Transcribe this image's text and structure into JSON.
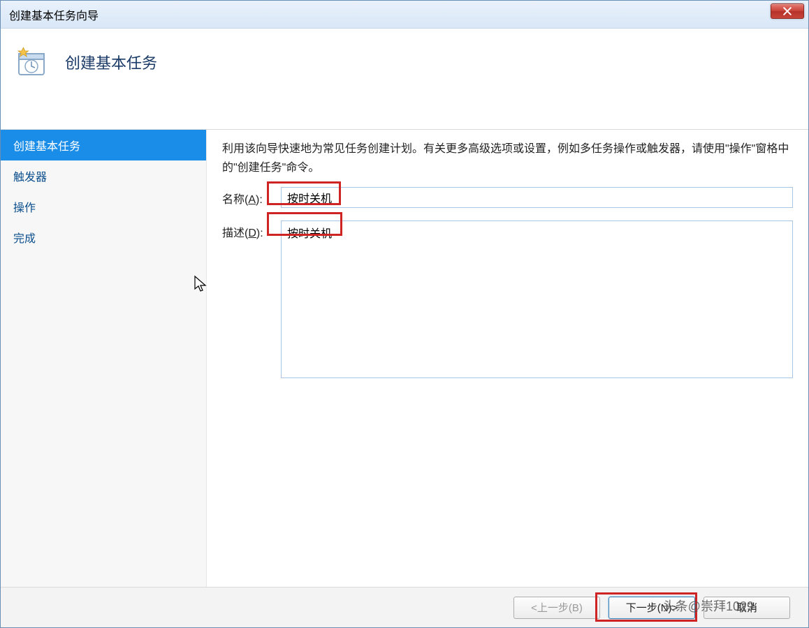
{
  "window": {
    "title": "创建基本任务向导"
  },
  "header": {
    "title": "创建基本任务"
  },
  "sidebar": {
    "items": [
      {
        "label": "创建基本任务",
        "active": true
      },
      {
        "label": "触发器",
        "active": false
      },
      {
        "label": "操作",
        "active": false
      },
      {
        "label": "完成",
        "active": false
      }
    ]
  },
  "main": {
    "intro": "利用该向导快速地为常见任务创建计划。有关更多高级选项或设置，例如多任务操作或触发器，请使用\"操作\"窗格中的\"创建任务\"命令。",
    "name_label_pre": "名称(",
    "name_label_key": "A",
    "name_label_post": "):",
    "name_value": "按时关机",
    "desc_label_pre": "描述(",
    "desc_label_key": "D",
    "desc_label_post": "):",
    "desc_value": "按时关机"
  },
  "footer": {
    "back": "<上一步(B)",
    "next": "下一步(N)>",
    "cancel": "取消"
  },
  "watermark": "头条@崇拜1029"
}
